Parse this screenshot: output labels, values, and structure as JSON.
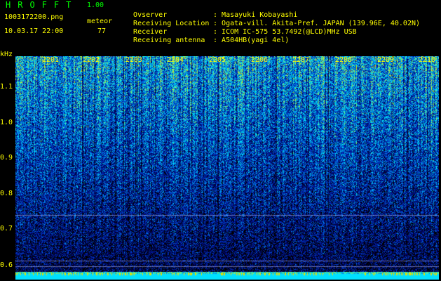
{
  "header": {
    "app_title": "HROFFT",
    "version": "1.00",
    "filename": "1003172200.png",
    "meteor_label": "meteor",
    "datetime": "10.03.17 22:00",
    "meteor_count": "77",
    "meta": [
      {
        "label": "Ovserver",
        "value": "Masayuki Kobayashi"
      },
      {
        "label": "Receiving Location",
        "value": "Ogata-vill. Akita-Pref. JAPAN (139.96E, 40.02N)"
      },
      {
        "label": "Receiver",
        "value": "ICOM IC-575 53.7492(@LCD)MHz USB"
      },
      {
        "label": "Receiving antenna",
        "value": "A504HB(yagi 4el)"
      }
    ]
  },
  "spectrogram": {
    "y_unit": "kHz",
    "y_ticks": [
      "1.1",
      "1.0",
      "0.9",
      "0.8",
      "0.7",
      "0.6"
    ],
    "x_ticks": [
      "2201",
      "2202",
      "2203",
      "2204",
      "2205",
      "2206",
      "2207",
      "2208",
      "2209",
      "2210"
    ],
    "colors": {
      "background": "#000000",
      "label": "#ffff00",
      "title": "#00ff00"
    }
  }
}
